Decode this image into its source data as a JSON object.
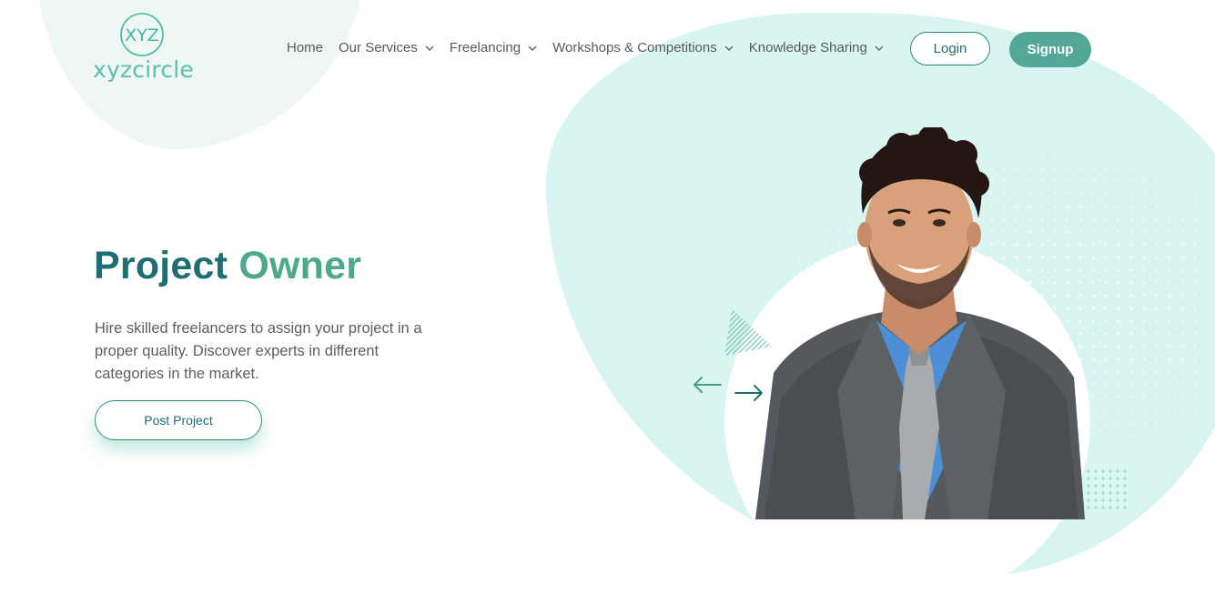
{
  "brand": {
    "logo_text": "xyzcircle",
    "logo_mark": "XYZ"
  },
  "nav": {
    "items": [
      {
        "label": "Home",
        "has_dropdown": false
      },
      {
        "label": "Our Services",
        "has_dropdown": true
      },
      {
        "label": "Freelancing",
        "has_dropdown": true
      },
      {
        "label": "Workshops & Competitions",
        "has_dropdown": true
      },
      {
        "label": "Knowledge Sharing",
        "has_dropdown": true
      }
    ],
    "login_label": "Login",
    "signup_label": "Signup"
  },
  "hero": {
    "title_main": "Project",
    "title_accent": "Owner",
    "description": "Hire skilled freelancers to assign your project in a proper quality. Discover experts in different categories in the market.",
    "cta_label": "Post Project"
  },
  "carousel": {
    "prev_icon": "arrow-left-icon",
    "next_icon": "arrow-right-icon"
  },
  "colors": {
    "primary": "#1f6f72",
    "accent": "#4daa86",
    "button_fill": "#52a796",
    "blob": "#d8f5f1"
  }
}
